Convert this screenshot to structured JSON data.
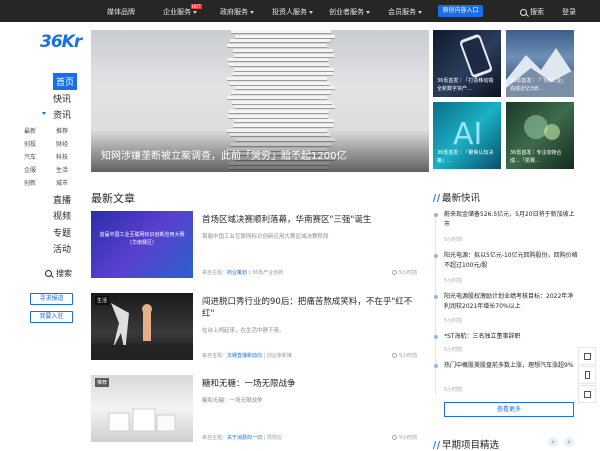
{
  "topnav": {
    "items": [
      {
        "label": "媒体品牌"
      },
      {
        "label": "企业服务",
        "badge": "HOT"
      },
      {
        "label": "政府服务"
      },
      {
        "label": "投资人服务"
      },
      {
        "label": "创业者服务"
      },
      {
        "label": "会员服务"
      }
    ],
    "highlight": "原创内容入口",
    "search": "搜索",
    "login": "登录"
  },
  "sidebar": {
    "logo_text": "36",
    "logo_suffix": "Kr",
    "main": [
      "首页",
      "快讯",
      "资讯"
    ],
    "sub": [
      [
        "最新",
        "推荐"
      ],
      [
        "创投",
        "财经"
      ],
      [
        "汽车",
        "科技"
      ],
      [
        "企服",
        "生活"
      ],
      [
        "创新",
        "城市"
      ]
    ],
    "main2": [
      "直播",
      "视频",
      "专题",
      "活动"
    ],
    "search": "搜索",
    "btn_report": "寻求报道",
    "btn_join": "我要入驻"
  },
  "hero": {
    "title": "知网涉嫌垄断被立案调查，此前「哭穷」赔不起1200亿"
  },
  "side_cards": [
    {
      "caption": "36氪首发｜「打造移动端全新数字资产…"
    },
    {
      "caption": "36氪首发｜「飞育工业」完成近亿元B…"
    },
    {
      "caption": "36氪首发｜「聚焦认知决策」…"
    },
    {
      "caption": "36氪首发｜专注动物合成…「凯赛…"
    }
  ],
  "latest": {
    "title": "最新文章",
    "articles": [
      {
        "tag": "",
        "img_text": "首届中国工业互联网标识创新应用大赛 (华南赛区)",
        "title": "首场区域决赛顺利落幕，华南赛区\"三强\"诞生",
        "desc": "首届中国工业互联网标识创新应用大赛区域决赛阶段",
        "source_prefix": "来自主题：",
        "source": "商业策划",
        "column": "36氪产业创新",
        "time": "5小时前"
      },
      {
        "tag": "生活",
        "img_text": "",
        "title": "闯进脱口秀行业的90后：把痛苦熬成笑料，不在乎\"红不红\"",
        "desc": "在台上闯起来，在生活中静下来。",
        "source_prefix": "来自主题：",
        "source": "文娱直播新动向",
        "column": "创业家新媒",
        "time": "5小时前"
      },
      {
        "tag": "推荐",
        "img_text": "",
        "title": "糖和无糖：一场无限战争",
        "desc": "糖和无糖：一场无限战争",
        "source_prefix": "来自主题：",
        "source": "关于消费的一切",
        "column": "周现在",
        "time": "5小时前"
      }
    ]
  },
  "flash": {
    "title": "最新快讯",
    "items": [
      {
        "text": "蔚来现金储备526.5亿元，5月20日将于新加坡上市",
        "time": "5小时前"
      },
      {
        "text": "阳光电源：拟以5亿元-10亿元回购股份，回购价格不超过100元/股",
        "time": "5小时前"
      },
      {
        "text": "阳光电源股权激励计划业绩考核目标：2022年净利润较2021年增长70%以上",
        "time": "5小时前"
      },
      {
        "text": "*ST海航：三名独立董事辞职",
        "time": "5小时前"
      },
      {
        "text": "热门中概股美股盘前多数上涨，理想汽车涨超9%",
        "time": "5小时前"
      }
    ],
    "more": "查看更多"
  },
  "early": {
    "title": "早期项目精选",
    "prev": "‹",
    "next": "›"
  },
  "colors": {
    "accent": "#1a6fe8",
    "topbar": "#262626",
    "hot": "#ff3b30"
  }
}
